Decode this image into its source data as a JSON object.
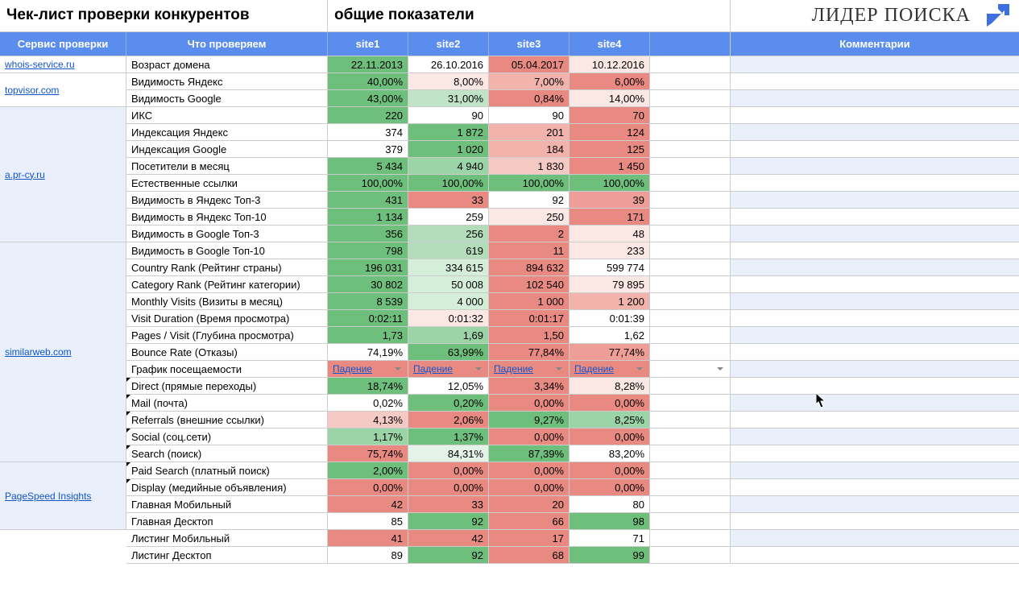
{
  "titles": {
    "left": "Чек-лист проверки конкурентов",
    "mid": "общие показатели",
    "brand": "Лидер Поиска"
  },
  "headers": {
    "service": "Сервис проверки",
    "param": "Что проверяем",
    "sites": [
      "site1",
      "site2",
      "site3",
      "site4"
    ],
    "comments": "Комментарии"
  },
  "services": [
    {
      "name": "whois-service.ru",
      "link": true,
      "rows": 1,
      "bg": "#fff"
    },
    {
      "name": "topvisor.com",
      "link": true,
      "rows": 2,
      "bg": "#fff"
    },
    {
      "name": "a.pr-cy.ru",
      "link": true,
      "rows": 8,
      "bg": "#e9f0fc"
    },
    {
      "name": "similarweb.com",
      "link": true,
      "rows": 13,
      "bg": "#e9f0fc"
    },
    {
      "name": "PageSpeed Insights",
      "link": true,
      "rows": 4,
      "bg": "#e9f0fc"
    }
  ],
  "rows": [
    {
      "p": "Возраст домена",
      "t": "",
      "cells": [
        {
          "v": "22.11.2013",
          "bg": "#6fbf7c"
        },
        {
          "v": "26.10.2016",
          "bg": "#ffffff"
        },
        {
          "v": "05.04.2017",
          "bg": "#e88a82"
        },
        {
          "v": "10.12.2016",
          "bg": "#fbe7e4"
        }
      ]
    },
    {
      "p": "Видимость Яндекс",
      "t": "",
      "cells": [
        {
          "v": "40,00%",
          "bg": "#6fbf7c"
        },
        {
          "v": "8,00%",
          "bg": "#fbe7e4"
        },
        {
          "v": "7,00%",
          "bg": "#f1b3ac"
        },
        {
          "v": "6,00%",
          "bg": "#e88a82"
        }
      ]
    },
    {
      "p": "Видимость Google",
      "t": "",
      "cells": [
        {
          "v": "43,00%",
          "bg": "#6fbf7c"
        },
        {
          "v": "31,00%",
          "bg": "#c1e3c8"
        },
        {
          "v": "0,84%",
          "bg": "#e88a82"
        },
        {
          "v": "14,00%",
          "bg": "#fbe7e4"
        }
      ]
    },
    {
      "p": "ИКС",
      "t": "",
      "cells": [
        {
          "v": "220",
          "bg": "#6fbf7c"
        },
        {
          "v": "90",
          "bg": "#ffffff"
        },
        {
          "v": "90",
          "bg": "#ffffff"
        },
        {
          "v": "70",
          "bg": "#e88a82"
        }
      ]
    },
    {
      "p": "Индексация Яндекс",
      "t": "",
      "cells": [
        {
          "v": "374",
          "bg": "#ffffff"
        },
        {
          "v": "1 872",
          "bg": "#6fbf7c"
        },
        {
          "v": "201",
          "bg": "#f1b3ac"
        },
        {
          "v": "124",
          "bg": "#e88a82"
        }
      ]
    },
    {
      "p": "Индексация Google",
      "t": "",
      "cells": [
        {
          "v": "379",
          "bg": "#ffffff"
        },
        {
          "v": "1 020",
          "bg": "#6fbf7c"
        },
        {
          "v": "184",
          "bg": "#f1b3ac"
        },
        {
          "v": "125",
          "bg": "#e88a82"
        }
      ]
    },
    {
      "p": "Посетители в месяц",
      "t": "",
      "cells": [
        {
          "v": "5 434",
          "bg": "#6fbf7c"
        },
        {
          "v": "4 940",
          "bg": "#9bd4a6"
        },
        {
          "v": "1 830",
          "bg": "#f5c9c4"
        },
        {
          "v": "1 450",
          "bg": "#e88a82"
        }
      ]
    },
    {
      "p": "Естественные ссылки",
      "t": "",
      "cells": [
        {
          "v": "100,00%",
          "bg": "#6fbf7c"
        },
        {
          "v": "100,00%",
          "bg": "#6fbf7c"
        },
        {
          "v": "100,00%",
          "bg": "#6fbf7c"
        },
        {
          "v": "100,00%",
          "bg": "#6fbf7c"
        }
      ]
    },
    {
      "p": "Видимость в Яндекс Топ-3",
      "t": "",
      "cells": [
        {
          "v": "431",
          "bg": "#6fbf7c"
        },
        {
          "v": "33",
          "bg": "#e88a82"
        },
        {
          "v": "92",
          "bg": "#ffffff"
        },
        {
          "v": "39",
          "bg": "#ed9e96"
        }
      ]
    },
    {
      "p": "Видимость в Яндекс Топ-10",
      "t": "",
      "cells": [
        {
          "v": "1 134",
          "bg": "#6fbf7c"
        },
        {
          "v": "259",
          "bg": "#ffffff"
        },
        {
          "v": "250",
          "bg": "#fbe7e4"
        },
        {
          "v": "171",
          "bg": "#e88a82"
        }
      ]
    },
    {
      "p": "Видимость в Google Топ-3",
      "t": "",
      "cells": [
        {
          "v": "356",
          "bg": "#6fbf7c"
        },
        {
          "v": "256",
          "bg": "#b2dcba"
        },
        {
          "v": "2",
          "bg": "#e88a82"
        },
        {
          "v": "48",
          "bg": "#fbe7e4"
        }
      ]
    },
    {
      "p": "Видимость в Google Топ-10",
      "t": "",
      "cells": [
        {
          "v": "798",
          "bg": "#6fbf7c"
        },
        {
          "v": "619",
          "bg": "#b2dcba"
        },
        {
          "v": "11",
          "bg": "#e88a82"
        },
        {
          "v": "233",
          "bg": "#fbe7e4"
        }
      ]
    },
    {
      "p": "Country Rank (Рейтинг страны)",
      "t": "",
      "cells": [
        {
          "v": "196 031",
          "bg": "#6fbf7c"
        },
        {
          "v": "334 615",
          "bg": "#d5eeda"
        },
        {
          "v": "894 632",
          "bg": "#e88a82"
        },
        {
          "v": "599 774",
          "bg": "#ffffff"
        }
      ]
    },
    {
      "p": "Category Rank (Рейтинг категории)",
      "t": "",
      "cells": [
        {
          "v": "30 802",
          "bg": "#6fbf7c"
        },
        {
          "v": "50 008",
          "bg": "#d5eeda"
        },
        {
          "v": "102 540",
          "bg": "#e88a82"
        },
        {
          "v": "79 895",
          "bg": "#fbe7e4"
        }
      ]
    },
    {
      "p": "Monthly Visits (Визиты в месяц)",
      "t": "",
      "cells": [
        {
          "v": "8 539",
          "bg": "#6fbf7c"
        },
        {
          "v": "4 000",
          "bg": "#d5eeda"
        },
        {
          "v": "1 000",
          "bg": "#e88a82"
        },
        {
          "v": "1 200",
          "bg": "#f1b3ac"
        }
      ]
    },
    {
      "p": "Visit Duration (Время просмотра)",
      "t": "",
      "cells": [
        {
          "v": "0:02:11",
          "bg": "#6fbf7c"
        },
        {
          "v": "0:01:32",
          "bg": "#fbe7e4"
        },
        {
          "v": "0:01:17",
          "bg": "#e88a82"
        },
        {
          "v": "0:01:39",
          "bg": "#ffffff"
        }
      ]
    },
    {
      "p": "Pages / Visit (Глубина просмотра)",
      "t": "",
      "cells": [
        {
          "v": "1,73",
          "bg": "#6fbf7c"
        },
        {
          "v": "1,69",
          "bg": "#9bd4a6"
        },
        {
          "v": "1,50",
          "bg": "#e88a82"
        },
        {
          "v": "1,62",
          "bg": "#ffffff"
        }
      ]
    },
    {
      "p": "Bounce Rate (Отказы)",
      "t": "",
      "cells": [
        {
          "v": "74,19%",
          "bg": "#ffffff"
        },
        {
          "v": "63,99%",
          "bg": "#6fbf7c"
        },
        {
          "v": "77,84%",
          "bg": "#e88a82"
        },
        {
          "v": "77,74%",
          "bg": "#ed9e96"
        }
      ]
    },
    {
      "p": "График посещаемости",
      "t": "dropdown",
      "cells": [
        {
          "v": "Падение",
          "bg": "#e88a82"
        },
        {
          "v": "Падение",
          "bg": "#e88a82"
        },
        {
          "v": "Падение",
          "bg": "#e88a82"
        },
        {
          "v": "Падение",
          "bg": "#e88a82"
        }
      ]
    },
    {
      "p": "Direct (прямые переходы)",
      "t": "note",
      "cells": [
        {
          "v": "18,74%",
          "bg": "#6fbf7c"
        },
        {
          "v": "12,05%",
          "bg": "#ffffff"
        },
        {
          "v": "3,34%",
          "bg": "#e88a82"
        },
        {
          "v": "8,28%",
          "bg": "#fbe7e4"
        }
      ]
    },
    {
      "p": "Mail (почта)",
      "t": "note",
      "cells": [
        {
          "v": "0,02%",
          "bg": "#ffffff"
        },
        {
          "v": "0,20%",
          "bg": "#6fbf7c"
        },
        {
          "v": "0,00%",
          "bg": "#e88a82"
        },
        {
          "v": "0,00%",
          "bg": "#e88a82"
        }
      ]
    },
    {
      "p": "Referrals (внешние ссылки)",
      "t": "note",
      "cells": [
        {
          "v": "4,13%",
          "bg": "#f5c9c4"
        },
        {
          "v": "2,06%",
          "bg": "#e88a82"
        },
        {
          "v": "9,27%",
          "bg": "#6fbf7c"
        },
        {
          "v": "8,25%",
          "bg": "#9bd4a6"
        }
      ]
    },
    {
      "p": "Social (соц.сети)",
      "t": "note",
      "cells": [
        {
          "v": "1,17%",
          "bg": "#9bd4a6"
        },
        {
          "v": "1,37%",
          "bg": "#6fbf7c"
        },
        {
          "v": "0,00%",
          "bg": "#e88a82"
        },
        {
          "v": "0,00%",
          "bg": "#e88a82"
        }
      ]
    },
    {
      "p": "Search (поиск)",
      "t": "note",
      "cells": [
        {
          "v": "75,74%",
          "bg": "#e88a82"
        },
        {
          "v": "84,31%",
          "bg": "#e4f2e7"
        },
        {
          "v": "87,39%",
          "bg": "#6fbf7c"
        },
        {
          "v": "83,20%",
          "bg": "#ffffff"
        }
      ]
    },
    {
      "p": "Paid Search (платный поиск)",
      "t": "note",
      "cells": [
        {
          "v": "2,00%",
          "bg": "#6fbf7c"
        },
        {
          "v": "0,00%",
          "bg": "#e88a82"
        },
        {
          "v": "0,00%",
          "bg": "#e88a82"
        },
        {
          "v": "0,00%",
          "bg": "#e88a82"
        }
      ]
    },
    {
      "p": "Display (медийные объявления)",
      "t": "note",
      "cells": [
        {
          "v": "0,00%",
          "bg": "#e88a82"
        },
        {
          "v": "0,00%",
          "bg": "#e88a82"
        },
        {
          "v": "0,00%",
          "bg": "#e88a82"
        },
        {
          "v": "0,00%",
          "bg": "#e88a82"
        }
      ]
    },
    {
      "p": "Главная Мобильный",
      "t": "",
      "cells": [
        {
          "v": "42",
          "bg": "#e88a82"
        },
        {
          "v": "33",
          "bg": "#e88a82"
        },
        {
          "v": "20",
          "bg": "#e88a82"
        },
        {
          "v": "80",
          "bg": "#ffffff"
        }
      ]
    },
    {
      "p": "Главная Десктоп",
      "t": "",
      "cells": [
        {
          "v": "85",
          "bg": "#ffffff"
        },
        {
          "v": "92",
          "bg": "#6fbf7c"
        },
        {
          "v": "66",
          "bg": "#e88a82"
        },
        {
          "v": "98",
          "bg": "#6fbf7c"
        }
      ]
    },
    {
      "p": "Листинг Мобильный",
      "t": "",
      "cells": [
        {
          "v": "41",
          "bg": "#e88a82"
        },
        {
          "v": "42",
          "bg": "#e88a82"
        },
        {
          "v": "17",
          "bg": "#e88a82"
        },
        {
          "v": "71",
          "bg": "#ffffff"
        }
      ]
    },
    {
      "p": "Листинг Десктоп",
      "t": "",
      "cells": [
        {
          "v": "89",
          "bg": "#ffffff"
        },
        {
          "v": "92",
          "bg": "#6fbf7c"
        },
        {
          "v": "68",
          "bg": "#e88a82"
        },
        {
          "v": "99",
          "bg": "#6fbf7c"
        }
      ]
    }
  ]
}
